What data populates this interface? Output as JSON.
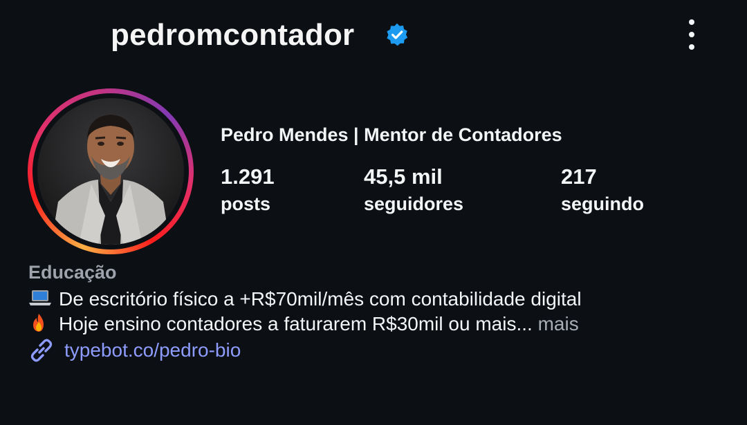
{
  "profile": {
    "username": "pedromcontador",
    "full_name": "Pedro Mendes | Mentor de Contadores",
    "category": "Educação",
    "verified_icon": "verified-badge-icon",
    "more_icon": "more-vertical-icon"
  },
  "stats": {
    "posts": {
      "value": "1.291",
      "label": "posts"
    },
    "followers": {
      "value": "45,5 mil",
      "label": "seguidores"
    },
    "following": {
      "value": "217",
      "label": "seguindo"
    }
  },
  "bio": {
    "line1": {
      "emoji": "laptop-icon",
      "text": "De escritório físico a +R$70mil/mês com contabilidade digital"
    },
    "line2": {
      "emoji": "fire-icon",
      "text": "Hoje ensino contadores a faturarem R$30mil ou mais...",
      "more": " mais"
    },
    "link": {
      "icon": "link-icon",
      "text": "typebot.co/pedro-bio"
    }
  },
  "colors": {
    "background": "#0c0f14",
    "verified": "#1d9bf0",
    "link": "#8e9cff",
    "muted": "#9ea3ab"
  }
}
